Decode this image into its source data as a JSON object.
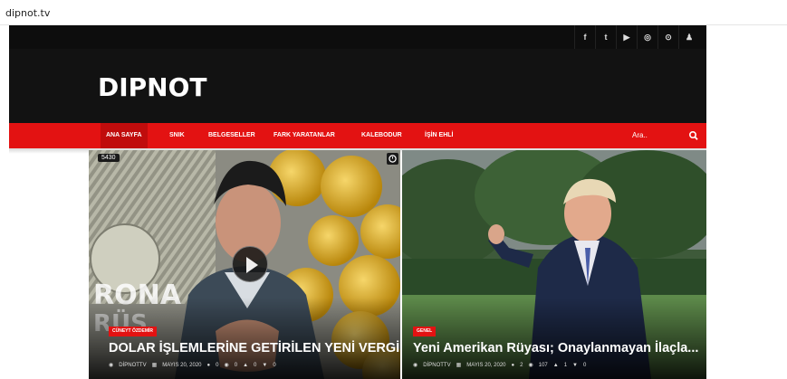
{
  "browser": {
    "url": "dipnot.tv"
  },
  "topbar": {
    "icons": [
      "facebook-icon",
      "twitter-icon",
      "youtube-icon",
      "instagram-icon",
      "settings-icon",
      "user-icon"
    ],
    "glyphs": [
      "f",
      "t",
      "▶",
      "◎",
      "⊙",
      "♟"
    ]
  },
  "header": {
    "logo": "DIPNOT"
  },
  "nav": {
    "items": [
      "ANA SAYFA",
      "SNIK",
      "BELGESELLER",
      "FARK YARATANLAR",
      "KALEBODUR",
      "İŞİN EHLİ"
    ],
    "search_placeholder": "Ara..",
    "active_color": "#c00c0c",
    "bar_color": "#e31212"
  },
  "posts": [
    {
      "views": "5430",
      "category": "CÜNEYT ÖZDEMİR",
      "title": "DOLAR İŞLEMLERİNE GETİRİLEN YENİ VERGİNİN P...",
      "author": "DİPNOTTV",
      "date": "MAYIS 20, 2020",
      "comments": "0",
      "views_count": "0",
      "likes": "0",
      "dislikes": "0"
    },
    {
      "category": "GENEL",
      "title": "Yeni Amerikan Rüyası; Onaylanmayan İlaçla...",
      "author": "DİPNOTTV",
      "date": "MAYIS 20, 2020",
      "comments": "2",
      "views_count": "107",
      "likes": "1",
      "dislikes": "0"
    }
  ]
}
